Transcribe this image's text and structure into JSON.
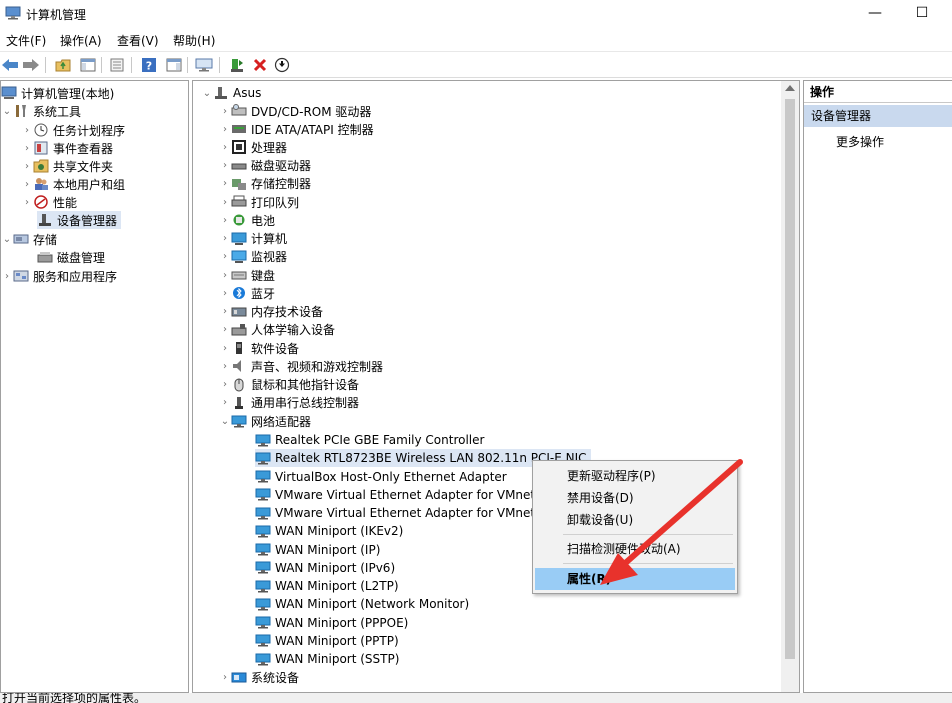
{
  "window": {
    "title": "计算机管理",
    "minimize": "—",
    "maximize": "☐"
  },
  "menu": [
    "文件(F)",
    "操作(A)",
    "查看(V)",
    "帮助(H)"
  ],
  "left_tree": {
    "root": "计算机管理(本地)",
    "system_tools": "系统工具",
    "system_children": [
      "任务计划程序",
      "事件查看器",
      "共享文件夹",
      "本地用户和组",
      "性能",
      "设备管理器"
    ],
    "storage": "存储",
    "storage_children": [
      "磁盘管理"
    ],
    "services": "服务和应用程序"
  },
  "device_tree": {
    "root": "Asus",
    "categories": [
      "DVD/CD-ROM 驱动器",
      "IDE ATA/ATAPI 控制器",
      "处理器",
      "磁盘驱动器",
      "存储控制器",
      "打印队列",
      "电池",
      "计算机",
      "监视器",
      "键盘",
      "蓝牙",
      "内存技术设备",
      "人体学输入设备",
      "软件设备",
      "声音、视频和游戏控制器",
      "鼠标和其他指针设备",
      "通用串行总线控制器"
    ],
    "network_adapters": "网络适配器",
    "adapters": [
      "Realtek PCIe GBE Family Controller",
      "Realtek RTL8723BE Wireless LAN 802.11n PCI-E NIC",
      "VirtualBox Host-Only Ethernet Adapter",
      "VMware Virtual Ethernet Adapter for VMnet1",
      "VMware Virtual Ethernet Adapter for VMnet8",
      "WAN Miniport (IKEv2)",
      "WAN Miniport (IP)",
      "WAN Miniport (IPv6)",
      "WAN Miniport (L2TP)",
      "WAN Miniport (Network Monitor)",
      "WAN Miniport (PPPOE)",
      "WAN Miniport (PPTP)",
      "WAN Miniport (SSTP)"
    ],
    "system_devices": "系统设备"
  },
  "actions": {
    "header": "操作",
    "section": "设备管理器",
    "more": "更多操作"
  },
  "context_menu": {
    "update_driver": "更新驱动程序(P)",
    "disable_device": "禁用设备(D)",
    "uninstall_device": "卸载设备(U)",
    "scan_hardware": "扫描检测硬件改动(A)",
    "properties": "属性(R)"
  },
  "status": {
    "text": "打开当前选择项的属性表。"
  },
  "colors": {
    "selection": "#dce6f4",
    "menu_highlight": "#99ccf5",
    "arrow": "#e8322c"
  }
}
